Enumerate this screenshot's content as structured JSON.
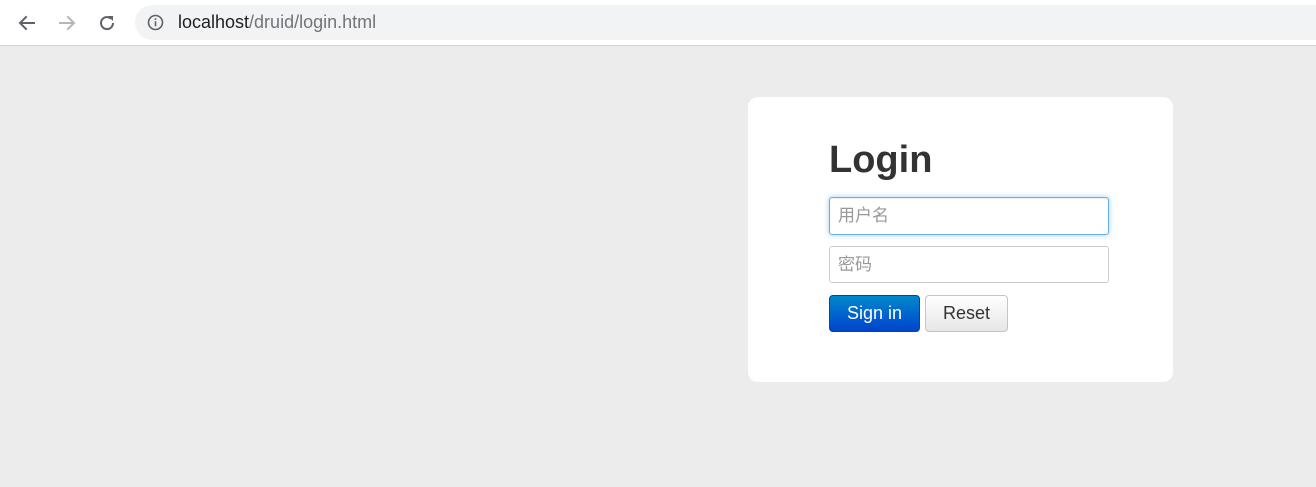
{
  "browser": {
    "url_host": "localhost",
    "url_path": "/druid/login.html",
    "icons": {
      "back": "back-arrow-icon",
      "forward": "forward-arrow-icon",
      "reload": "reload-icon",
      "info": "info-icon"
    }
  },
  "login": {
    "title": "Login",
    "username_placeholder": "用户名",
    "password_placeholder": "密码",
    "signin_label": "Sign in",
    "reset_label": "Reset"
  },
  "colors": {
    "page_background": "#ececec",
    "card_background": "#ffffff",
    "signin_gradient_top": "#0088cc",
    "signin_gradient_bottom": "#0044cc",
    "focus_border": "#66afe9"
  }
}
